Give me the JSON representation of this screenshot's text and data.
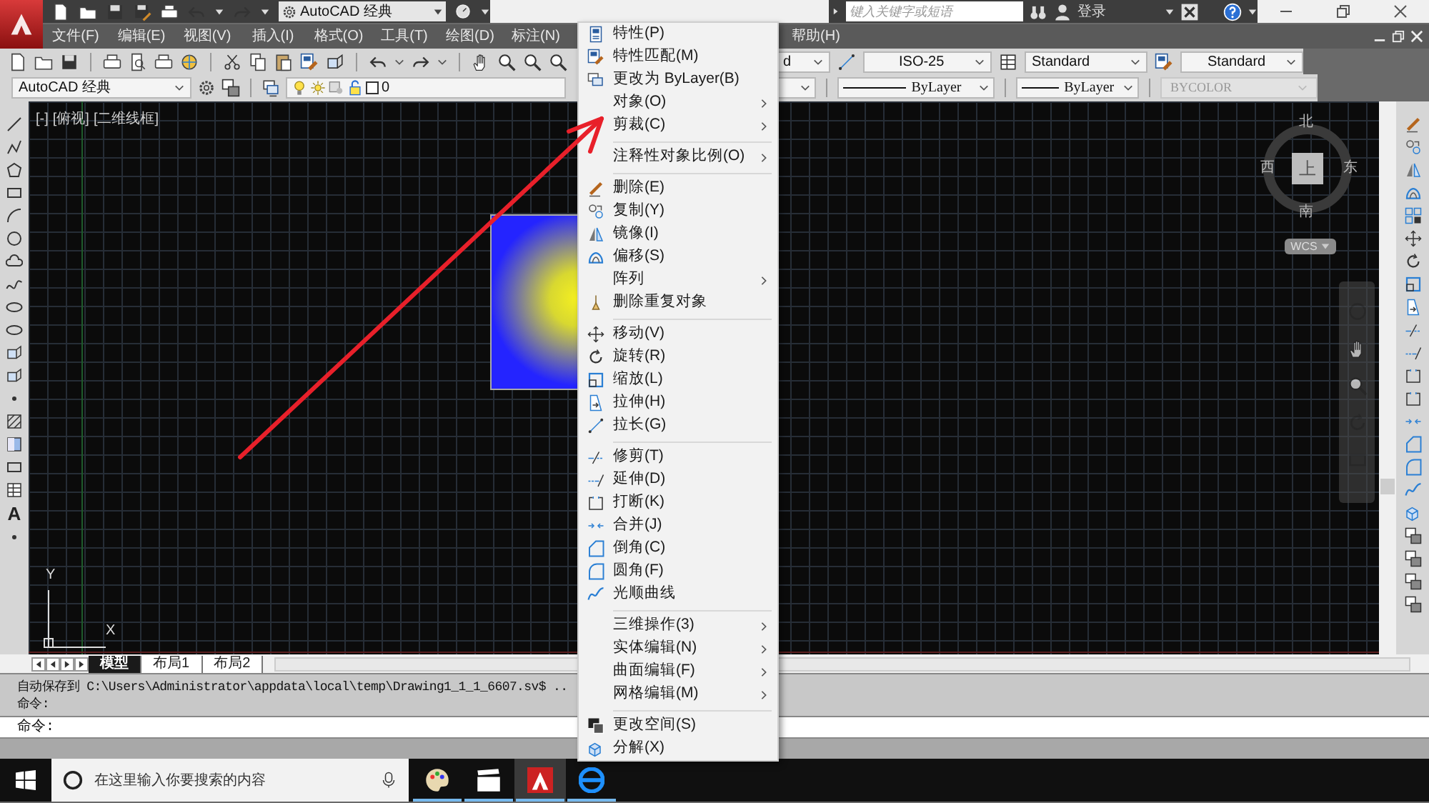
{
  "title_bar": {
    "workspace": "AutoCAD 经典",
    "search": {
      "placeholder": "键入关键字或短语"
    },
    "sign_in": "登录"
  },
  "menu_bar": {
    "items": [
      "文件(F)",
      "编辑(E)",
      "视图(V)",
      "插入(I)",
      "格式(O)",
      "工具(T)",
      "绘图(D)",
      "标注(N)"
    ],
    "help": "帮助(H)"
  },
  "styles_toolbar": [
    {
      "value": "d"
    },
    {
      "value": "ISO-25"
    },
    {
      "value": "Standard"
    },
    {
      "value": "Standard"
    }
  ],
  "layers_toolbar": {
    "workspace": "AutoCAD 经典",
    "layer": "0",
    "linetype": "ByLayer",
    "lineweight": "ByLayer",
    "plot_style": {
      "value": "BYCOLOR",
      "disabled": true
    }
  },
  "draw_toolbar": {
    "text_tool": "A"
  },
  "viewport": {
    "controls": "[-]",
    "view": "[俯视]",
    "visual_style": "[二维线框]"
  },
  "viewcube": {
    "north": "北",
    "south": "南",
    "east": "东",
    "west": "西",
    "face": "上",
    "coordinate_system": "WCS"
  },
  "ucs_icon": {
    "x": "X",
    "y": "Y"
  },
  "layout_tabs": [
    {
      "label": "模型",
      "selected": true
    },
    {
      "label": "布局1",
      "selected": false
    },
    {
      "label": "布局2",
      "selected": false
    }
  ],
  "command_history": [
    "自动保存到 C:\\Users\\Administrator\\appdata\\local\\temp\\Drawing1_1_1_6607.sv$ ..",
    "命令:"
  ],
  "command_line": {
    "prompt": "命令:"
  },
  "context_menu": {
    "items": [
      {
        "kind": "item",
        "label": "特性(P)",
        "submenu": false
      },
      {
        "kind": "item",
        "label": "特性匹配(M)",
        "submenu": false
      },
      {
        "kind": "item",
        "label": "更改为 ByLayer(B)",
        "submenu": false
      },
      {
        "kind": "item",
        "label": "对象(O)",
        "submenu": true
      },
      {
        "kind": "item",
        "label": "剪裁(C)",
        "submenu": true
      },
      {
        "kind": "separator"
      },
      {
        "kind": "item",
        "label": "注释性对象比例(O)",
        "submenu": true
      },
      {
        "kind": "separator"
      },
      {
        "kind": "item",
        "label": "删除(E)",
        "submenu": false
      },
      {
        "kind": "item",
        "label": "复制(Y)",
        "submenu": false
      },
      {
        "kind": "item",
        "label": "镜像(I)",
        "submenu": false
      },
      {
        "kind": "item",
        "label": "偏移(S)",
        "submenu": false
      },
      {
        "kind": "item",
        "label": "阵列",
        "submenu": true
      },
      {
        "kind": "item",
        "label": "删除重复对象",
        "submenu": false
      },
      {
        "kind": "separator"
      },
      {
        "kind": "item",
        "label": "移动(V)",
        "submenu": false
      },
      {
        "kind": "item",
        "label": "旋转(R)",
        "submenu": false
      },
      {
        "kind": "item",
        "label": "缩放(L)",
        "submenu": false
      },
      {
        "kind": "item",
        "label": "拉伸(H)",
        "submenu": false
      },
      {
        "kind": "item",
        "label": "拉长(G)",
        "submenu": false
      },
      {
        "kind": "separator"
      },
      {
        "kind": "item",
        "label": "修剪(T)",
        "submenu": false
      },
      {
        "kind": "item",
        "label": "延伸(D)",
        "submenu": false
      },
      {
        "kind": "item",
        "label": "打断(K)",
        "submenu": false
      },
      {
        "kind": "item",
        "label": "合并(J)",
        "submenu": false
      },
      {
        "kind": "item",
        "label": "倒角(C)",
        "submenu": false
      },
      {
        "kind": "item",
        "label": "圆角(F)",
        "submenu": false
      },
      {
        "kind": "item",
        "label": "光顺曲线",
        "submenu": false
      },
      {
        "kind": "separator"
      },
      {
        "kind": "item",
        "label": "三维操作(3)",
        "submenu": true
      },
      {
        "kind": "item",
        "label": "实体编辑(N)",
        "submenu": true
      },
      {
        "kind": "item",
        "label": "曲面编辑(F)",
        "submenu": true
      },
      {
        "kind": "item",
        "label": "网格编辑(M)",
        "submenu": true
      },
      {
        "kind": "separator"
      },
      {
        "kind": "item",
        "label": "更改空间(S)",
        "submenu": false
      },
      {
        "kind": "item",
        "label": "分解(X)",
        "submenu": false
      }
    ]
  },
  "taskbar": {
    "search": {
      "placeholder": "在这里输入你要搜索的内容"
    },
    "apps": [
      {
        "selected": false
      },
      {
        "selected": false
      },
      {
        "selected": true
      },
      {
        "selected": false
      }
    ]
  }
}
